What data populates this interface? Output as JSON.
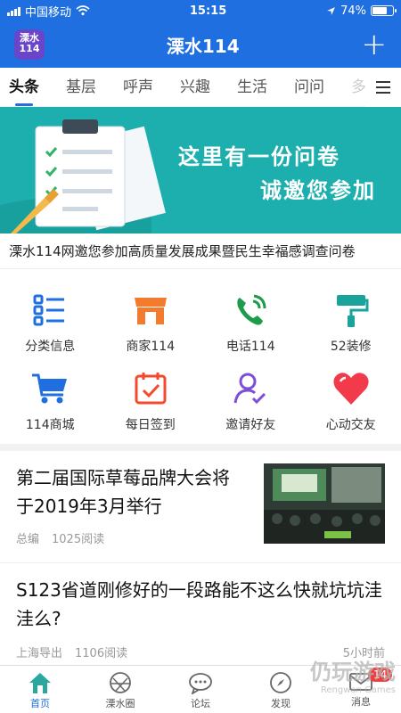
{
  "status_bar": {
    "carrier": "中国移动",
    "time": "15:15",
    "battery_percent": 74,
    "battery_text": "74%"
  },
  "header": {
    "title": "溧水114",
    "logo_text": "溧水114",
    "colors": {
      "primary": "#1f6fe0"
    }
  },
  "tabs": [
    {
      "label": "头条",
      "active": true
    },
    {
      "label": "基层",
      "active": false
    },
    {
      "label": "呼声",
      "active": false
    },
    {
      "label": "兴趣",
      "active": false
    },
    {
      "label": "生活",
      "active": false
    },
    {
      "label": "问问",
      "active": false
    },
    {
      "label": "多",
      "active": false
    }
  ],
  "banner": {
    "line1": "这里有一份问卷",
    "line2": "诚邀您参加",
    "caption": "溧水114网邀您参加高质量发展成果暨民生幸福感调查问卷"
  },
  "grid": [
    {
      "label": "分类信息",
      "icon": "list-icon"
    },
    {
      "label": "商家114",
      "icon": "shop-icon"
    },
    {
      "label": "电话114",
      "icon": "phone-icon"
    },
    {
      "label": "52装修",
      "icon": "paint-roller-icon"
    },
    {
      "label": "114商城",
      "icon": "cart-icon"
    },
    {
      "label": "每日签到",
      "icon": "calendar-check-icon"
    },
    {
      "label": "邀请好友",
      "icon": "user-check-icon"
    },
    {
      "label": "心动交友",
      "icon": "heart-icon"
    }
  ],
  "articles": [
    {
      "title": "第二届国际草莓品牌大会将于2019年3月举行",
      "author": "总编",
      "reads": "1025阅读"
    },
    {
      "title": "S123省道刚修好的一段路能不这么快就坑坑洼洼么?",
      "author": "上海导出",
      "reads": "1106阅读",
      "time": "5小时前"
    }
  ],
  "bottom_nav": [
    {
      "label": "首页",
      "icon": "home-icon",
      "active": true
    },
    {
      "label": "溧水圈",
      "icon": "circle-icon",
      "active": false
    },
    {
      "label": "论坛",
      "icon": "chat-icon",
      "active": false
    },
    {
      "label": "发现",
      "icon": "compass-icon",
      "active": false
    },
    {
      "label": "消息",
      "icon": "mail-icon",
      "active": false,
      "badge": "14"
    }
  ],
  "watermark": {
    "title": "仍玩游戏",
    "subtitle": "Rengwan Games"
  }
}
